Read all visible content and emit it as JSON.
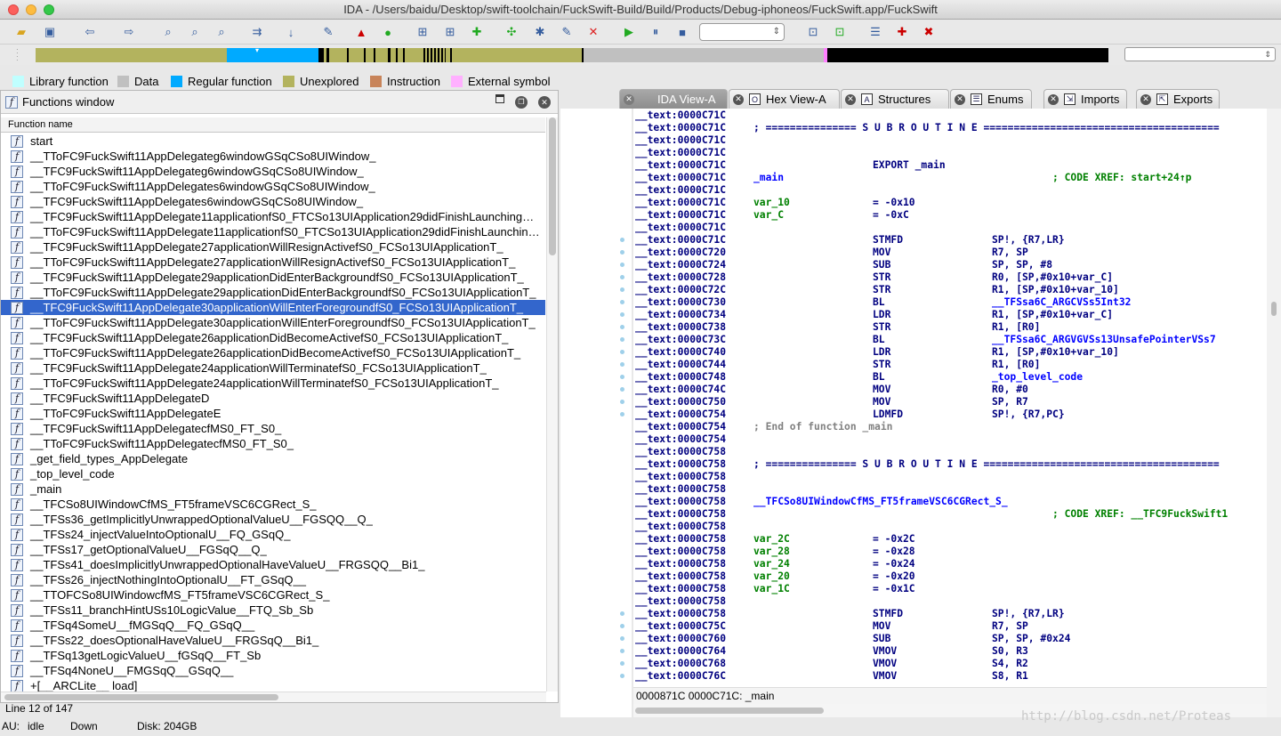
{
  "window": {
    "title": "IDA - /Users/baidu/Desktop/swift-toolchain/FuckSwift-Build/Build/Products/Debug-iphoneos/FuckSwift.app/FuckSwift"
  },
  "legend": [
    {
      "label": "Library function",
      "color": "#c0ffff"
    },
    {
      "label": "Data",
      "color": "#c0c0c0"
    },
    {
      "label": "Regular function",
      "color": "#00aaff"
    },
    {
      "label": "Unexplored",
      "color": "#b3b35e"
    },
    {
      "label": "Instruction",
      "color": "#c8845a"
    },
    {
      "label": "External symbol",
      "color": "#ffb0ff"
    }
  ],
  "functions_window": {
    "title": "Functions window",
    "column_header": "Function name",
    "selected_index": 11,
    "items": [
      "start",
      "__TToFC9FuckSwift11AppDelegateg6windowGSqCSo8UIWindow_",
      "__TFC9FuckSwift11AppDelegateg6windowGSqCSo8UIWindow_",
      "__TToFC9FuckSwift11AppDelegates6windowGSqCSo8UIWindow_",
      "__TFC9FuckSwift11AppDelegates6windowGSqCSo8UIWindow_",
      "__TFC9FuckSwift11AppDelegate11applicationfS0_FTCSo13UIApplication29didFinishLaunching…",
      "__TToFC9FuckSwift11AppDelegate11applicationfS0_FTCSo13UIApplication29didFinishLaunchin…",
      "__TFC9FuckSwift11AppDelegate27applicationWillResignActivefS0_FCSo13UIApplicationT_",
      "__TToFC9FuckSwift11AppDelegate27applicationWillResignActivefS0_FCSo13UIApplicationT_",
      "__TFC9FuckSwift11AppDelegate29applicationDidEnterBackgroundfS0_FCSo13UIApplicationT_",
      "__TToFC9FuckSwift11AppDelegate29applicationDidEnterBackgroundfS0_FCSo13UIApplicationT_",
      "__TFC9FuckSwift11AppDelegate30applicationWillEnterForegroundfS0_FCSo13UIApplicationT_",
      "__TToFC9FuckSwift11AppDelegate30applicationWillEnterForegroundfS0_FCSo13UIApplicationT_",
      "__TFC9FuckSwift11AppDelegate26applicationDidBecomeActivefS0_FCSo13UIApplicationT_",
      "__TToFC9FuckSwift11AppDelegate26applicationDidBecomeActivefS0_FCSo13UIApplicationT_",
      "__TFC9FuckSwift11AppDelegate24applicationWillTerminatefS0_FCSo13UIApplicationT_",
      "__TToFC9FuckSwift11AppDelegate24applicationWillTerminatefS0_FCSo13UIApplicationT_",
      "__TFC9FuckSwift11AppDelegateD",
      "__TToFC9FuckSwift11AppDelegateE",
      "__TFC9FuckSwift11AppDelegatecfMS0_FT_S0_",
      "__TToFC9FuckSwift11AppDelegatecfMS0_FT_S0_",
      "_get_field_types_AppDelegate",
      "_top_level_code",
      "_main",
      "__TFCSo8UIWindowCfMS_FT5frameVSC6CGRect_S_",
      "__TFSs36_getImplicitlyUnwrappedOptionalValueU__FGSQQ__Q_",
      "__TFSs24_injectValueIntoOptionalU__FQ_GSqQ_",
      "__TFSs17_getOptionalValueU__FGSqQ__Q_",
      "__TFSs41_doesImplicitlyUnwrappedOptionalHaveValueU__FRGSQQ__Bi1_",
      "__TFSs26_injectNothingIntoOptionalU__FT_GSqQ__",
      "__TTOFCSo8UIWindowcfMS_FT5frameVSC6CGRect_S_",
      "__TFSs11_branchHintUSs10LogicValue__FTQ_Sb_Sb",
      "__TFSq4SomeU__fMGSqQ__FQ_GSqQ__",
      "__TFSs22_doesOptionalHaveValueU__FRGSqQ__Bi1_",
      "__TFSq13getLogicValueU__fGSqQ__FT_Sb",
      "__TFSq4NoneU__FMGSqQ__GSqQ__",
      "+[__ARCLite__ load]"
    ]
  },
  "status": {
    "line": "Line 12 of 147",
    "au_label": "AU:",
    "au_value": "idle",
    "direction": "Down",
    "disk": "Disk: 204GB"
  },
  "tabs": [
    "IDA View-A",
    "Hex View-A",
    "Structures",
    "Enums",
    "Imports",
    "Exports"
  ],
  "disasm": [
    {
      "addr": "__text:0000C71C"
    },
    {
      "addr": "__text:0000C71C",
      "sep": "; =============== S U B R O U T I N E ======================================="
    },
    {
      "addr": "__text:0000C71C"
    },
    {
      "addr": "__text:0000C71C"
    },
    {
      "addr": "__text:0000C71C",
      "mn": "EXPORT _main"
    },
    {
      "addr": "__text:0000C71C",
      "lbl": "_main",
      "xref": "; CODE XREF: start+24↑p"
    },
    {
      "addr": "__text:0000C71C"
    },
    {
      "addr": "__text:0000C71C",
      "var": "var_10",
      "mn": "= -0x10"
    },
    {
      "addr": "__text:0000C71C",
      "var": "var_C",
      "mn": "= -0xC"
    },
    {
      "addr": "__text:0000C71C"
    },
    {
      "addr": "__text:0000C71C",
      "mn": "STMFD",
      "op": "SP!, {R7,LR}"
    },
    {
      "addr": "__text:0000C720",
      "mn": "MOV",
      "op": "R7, SP"
    },
    {
      "addr": "__text:0000C724",
      "mn": "SUB",
      "op": "SP, SP, #8"
    },
    {
      "addr": "__text:0000C728",
      "mn": "STR",
      "op": "R0, [SP,#0x10+var_C]"
    },
    {
      "addr": "__text:0000C72C",
      "mn": "STR",
      "op": "R1, [SP,#0x10+var_10]"
    },
    {
      "addr": "__text:0000C730",
      "mn": "BL",
      "op": "__TFSsa6C_ARGCVSs5Int32",
      "oplink": true
    },
    {
      "addr": "__text:0000C734",
      "mn": "LDR",
      "op": "R1, [SP,#0x10+var_C]"
    },
    {
      "addr": "__text:0000C738",
      "mn": "STR",
      "op": "R1, [R0]"
    },
    {
      "addr": "__text:0000C73C",
      "mn": "BL",
      "op": "__TFSsa6C_ARGVGVSs13UnsafePointerVSs7",
      "oplink": true
    },
    {
      "addr": "__text:0000C740",
      "mn": "LDR",
      "op": "R1, [SP,#0x10+var_10]"
    },
    {
      "addr": "__text:0000C744",
      "mn": "STR",
      "op": "R1, [R0]"
    },
    {
      "addr": "__text:0000C748",
      "mn": "BL",
      "op": "_top_level_code",
      "oplink": true
    },
    {
      "addr": "__text:0000C74C",
      "mn": "MOV",
      "op": "R0, #0"
    },
    {
      "addr": "__text:0000C750",
      "mn": "MOV",
      "op": "SP, R7"
    },
    {
      "addr": "__text:0000C754",
      "mn": "LDMFD",
      "op": "SP!, {R7,PC}"
    },
    {
      "addr": "__text:0000C754",
      "fn": "; End of function _main"
    },
    {
      "addr": "__text:0000C754"
    },
    {
      "addr": "__text:0000C758"
    },
    {
      "addr": "__text:0000C758",
      "sep": "; =============== S U B R O U T I N E ======================================="
    },
    {
      "addr": "__text:0000C758"
    },
    {
      "addr": "__text:0000C758"
    },
    {
      "addr": "__text:0000C758",
      "lbl": "__TFCSo8UIWindowCfMS_FT5frameVSC6CGRect_S_"
    },
    {
      "addr": "__text:0000C758",
      "xref": "; CODE XREF: __TFC9FuckSwift1"
    },
    {
      "addr": "__text:0000C758"
    },
    {
      "addr": "__text:0000C758",
      "var": "var_2C",
      "mn": "= -0x2C"
    },
    {
      "addr": "__text:0000C758",
      "var": "var_28",
      "mn": "= -0x28"
    },
    {
      "addr": "__text:0000C758",
      "var": "var_24",
      "mn": "= -0x24"
    },
    {
      "addr": "__text:0000C758",
      "var": "var_20",
      "mn": "= -0x20"
    },
    {
      "addr": "__text:0000C758",
      "var": "var_1C",
      "mn": "= -0x1C"
    },
    {
      "addr": "__text:0000C758"
    },
    {
      "addr": "__text:0000C758",
      "mn": "STMFD",
      "op": "SP!, {R7,LR}"
    },
    {
      "addr": "__text:0000C75C",
      "mn": "MOV",
      "op": "R7, SP"
    },
    {
      "addr": "__text:0000C760",
      "mn": "SUB",
      "op": "SP, SP, #0x24"
    },
    {
      "addr": "__text:0000C764",
      "mn": "VMOV",
      "op": "S0, R3"
    },
    {
      "addr": "__text:0000C768",
      "mn": "VMOV",
      "op": "S4, R2"
    },
    {
      "addr": "__text:0000C76C",
      "mn": "VMOV",
      "op": "S8, R1"
    }
  ],
  "address_line": "0000871C 0000C71C: _main",
  "watermark": "http://blog.csdn.net/Proteas"
}
